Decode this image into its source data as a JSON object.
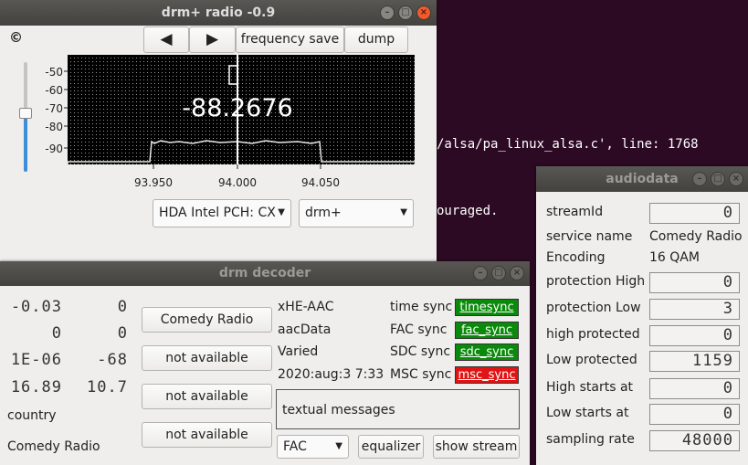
{
  "terminal": {
    "line1": "/alsa/pa_linux_alsa.c', line: 1768",
    "line2": "ouraged."
  },
  "radio": {
    "title": "drm+ radio -0.9",
    "copyright": "©",
    "prev_label": "◀",
    "next_label": "▶",
    "freq_save_label": "frequency save",
    "dump_label": "dump",
    "frequency_display": "-88.2676",
    "y_ticks": [
      "-50",
      "-60",
      "-70",
      "-80",
      "-90"
    ],
    "x_ticks": [
      "93.950",
      "94.000",
      "94.050"
    ],
    "device_select": "HDA Intel PCH: CX",
    "mode_select": "drm+",
    "slider_level": 0.35
  },
  "decoder": {
    "title": "drm decoder",
    "values": [
      {
        "left": "-0.03",
        "right": "0"
      },
      {
        "left": "0",
        "right": "0"
      },
      {
        "left": "1E-06",
        "right": "-68"
      },
      {
        "left": "16.89",
        "right": "10.7"
      }
    ],
    "country_label": "country",
    "station_label": "Comedy Radio",
    "services": [
      "Comedy Radio",
      "not available",
      "not available",
      "not available"
    ],
    "info": [
      "xHE-AAC",
      "aacData",
      "Varied",
      "2020:aug:3 7:33"
    ],
    "sync_labels": [
      "time sync",
      "FAC sync",
      "SDC sync",
      "MSC sync"
    ],
    "sync_states": [
      {
        "text": "timesync",
        "color": "#0a8a0a"
      },
      {
        "text": "fac_sync",
        "color": "#0a8a0a"
      },
      {
        "text": "sdc_sync",
        "color": "#0a8a0a"
      },
      {
        "text": "msc_sync",
        "color": "#e01414"
      }
    ],
    "textual_messages": "textual messages",
    "fac_select": "FAC",
    "equalizer_label": "equalizer",
    "show_stream_label": "show stream"
  },
  "audio": {
    "title": "audiodata",
    "rows": [
      {
        "label": "streamId",
        "value": "0",
        "lcd": true
      },
      {
        "label": "service name",
        "value": "Comedy Radio",
        "lcd": false
      },
      {
        "label": "Encoding",
        "value": "16 QAM",
        "lcd": false
      },
      {
        "label": "protection High",
        "value": "0",
        "lcd": true
      },
      {
        "label": "protection Low",
        "value": "3",
        "lcd": true
      },
      {
        "label": "high protected",
        "value": "0",
        "lcd": true
      },
      {
        "label": "Low protected",
        "value": "1159",
        "lcd": true
      },
      {
        "label": "High starts at",
        "value": "0",
        "lcd": true
      },
      {
        "label": "Low starts at",
        "value": "0",
        "lcd": true
      },
      {
        "label": "sampling rate",
        "value": "48000",
        "lcd": true
      }
    ]
  }
}
